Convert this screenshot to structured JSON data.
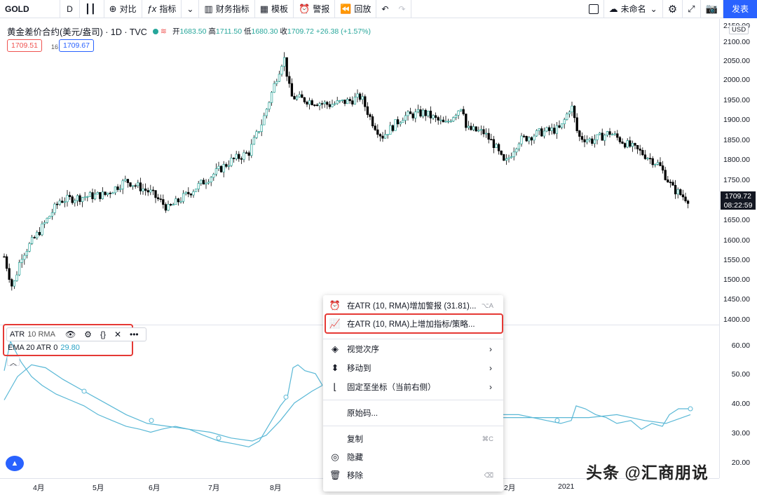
{
  "toolbar": {
    "symbol": "GOLD",
    "interval": "D",
    "compare": "对比",
    "indicators": "指标",
    "financials": "财务指标",
    "templates": "模板",
    "alert": "警报",
    "replay": "回放",
    "layout_name": "未命名",
    "publish": "发表"
  },
  "legend": {
    "title": "黄金差价合约(美元/盎司) · 1D · TVC",
    "open_label": "开",
    "open": "1683.50",
    "high_label": "高",
    "high": "1711.50",
    "low_label": "低",
    "low": "1680.30",
    "close_label": "收",
    "close": "1709.72",
    "change": "+26.38 (+1.57%)",
    "bid": "1709.51",
    "spread": "16",
    "ask": "1709.67"
  },
  "price_axis": {
    "currency": "USD",
    "labels": [
      "2150.00",
      "2100.00",
      "2050.00",
      "2000.00",
      "1950.00",
      "1900.00",
      "1850.00",
      "1800.00",
      "1750.00",
      "1650.00",
      "1600.00",
      "1550.00",
      "1500.00",
      "1450.00",
      "1400.00"
    ],
    "current_price": "1709.72",
    "countdown": "08:22:59"
  },
  "indicator_axis": {
    "labels": [
      "60.00",
      "50.00",
      "40.00",
      "30.00",
      "20.00"
    ]
  },
  "indicator": {
    "name": "ATR",
    "params": "10 RMA",
    "ema_label": "EMA 20 ATR 0",
    "ema_value": "29.80"
  },
  "time_axis": {
    "labels": [
      "4月",
      "5月",
      "6月",
      "7月",
      "8月",
      "2月",
      "2021"
    ]
  },
  "context_menu": {
    "items": [
      {
        "label": "在ATR (10, RMA)增加警报 (31.81)...",
        "shortcut": "⌥A"
      },
      {
        "label": "在ATR (10, RMA)上增加指标/策略..."
      },
      {
        "label": "视觉次序"
      },
      {
        "label": "移动到"
      },
      {
        "label": "固定至坐标（当前右侧）"
      },
      {
        "label": "原始码..."
      },
      {
        "label": "复制",
        "shortcut": "⌘C"
      },
      {
        "label": "隐藏"
      },
      {
        "label": "移除",
        "shortcut": "⌫"
      }
    ]
  },
  "watermark": "头条 @汇商朋说",
  "colors": {
    "up": "#26a69a",
    "down": "#000000",
    "atr_line": "#5ab8d6",
    "highlight": "#e53935",
    "accent": "#2962ff"
  }
}
